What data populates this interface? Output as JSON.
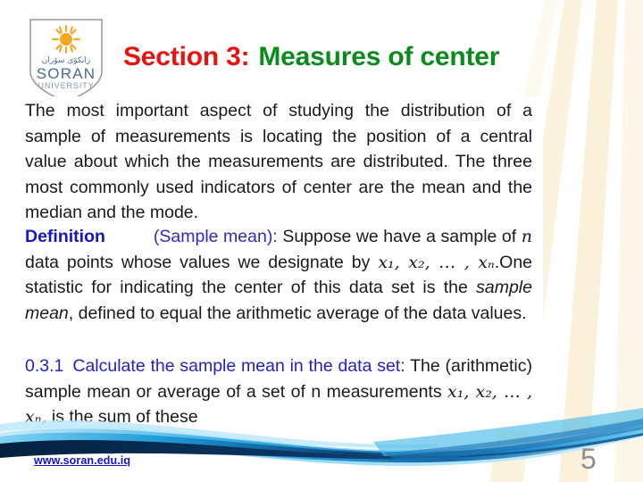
{
  "slide": {
    "page_number": "5",
    "footer_link": "www.soran.edu.iq"
  },
  "logo": {
    "name": "soran-university-logo",
    "kurdish_text": "زانكۆى سۆران",
    "line1": "SORAN",
    "line2": "UNIVERSITY",
    "shield_border_color": "#8f8f8f",
    "sun_color": "#f5a623",
    "wordmark_color": "#4a6c8f"
  },
  "title": {
    "section_label": "Section 3:",
    "section_label_color": "#e8130f",
    "subject": "Measures of center",
    "subject_color": "#0b8a1e"
  },
  "body": {
    "intro": {
      "line1": "The most important aspect of studying the distribution",
      "line2": "of a sample of measurements is locating the position of",
      "line3": "a central value about which the measurements are",
      "line4": "distributed. The three most commonly used indicators",
      "line5": "of center are the mean and the median and the mode."
    },
    "definition": {
      "label": "Definition",
      "label_color": "#1714c4",
      "term": "(Sample mean):",
      "term_color": "#2b2bbf",
      "text_a": "Suppose we have a sample of",
      "var_n": "n",
      "text_b": "data points whose values we designate by",
      "vars": "x₁, x₂, … , xₙ",
      "text_c": ".One statistic for indicating the center of this data set is the",
      "emphasis": "sample mean",
      "text_d": ", defined to equal the arithmetic average of the data values."
    },
    "calculate": {
      "number": "0.3.1",
      "number_color": "#2222c8",
      "heading": "Calculate the sample mean in the data set:",
      "heading_color": "#2222c8",
      "text_a": "The (arithmetic) sample mean or average of a set of n measurements",
      "vars": "x₁, x₂, … , xₙ,",
      "text_b": "is the sum of these"
    }
  },
  "decor": {
    "wave_colors": [
      "#0a2e5c",
      "#1565b5",
      "#23a9e8",
      "#6fd2f5",
      "#bfe9fb"
    ],
    "ray_color": "#fdf4e0"
  }
}
